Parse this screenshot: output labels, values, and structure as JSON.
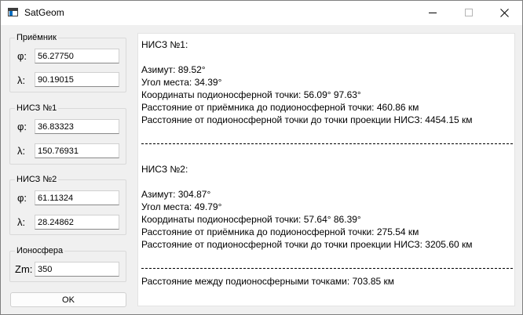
{
  "window": {
    "title": "SatGeom"
  },
  "receiver": {
    "title": "Приёмник",
    "phi_label": "φ:",
    "phi_value": "56.27750",
    "lambda_label": "λ:",
    "lambda_value": "90.19015"
  },
  "sat1": {
    "title": "НИСЗ №1",
    "phi_label": "φ:",
    "phi_value": "36.83323",
    "lambda_label": "λ:",
    "lambda_value": "150.76931"
  },
  "sat2": {
    "title": "НИСЗ №2",
    "phi_label": "φ:",
    "phi_value": "61.11324",
    "lambda_label": "λ:",
    "lambda_value": "28.24862"
  },
  "ionosphere": {
    "title": "Ионосфера",
    "zm_label": "Zm:",
    "zm_value": "350"
  },
  "ok_label": "OK",
  "output": {
    "sat1_header": "НИСЗ №1:",
    "sat1_azimuth": "Азимут: 89.52°",
    "sat1_elevation": "Угол места: 34.39°",
    "sat1_coords": "Координаты подионосферной точки: 56.09° 97.63°",
    "sat1_dist_receiver": "Расстояние от приёмника до подионосферной точки: 460.86 км",
    "sat1_dist_projection": "Расстояние от подионосферной точки до точки проекции НИСЗ: 4454.15 км",
    "sat2_header": "НИСЗ №2:",
    "sat2_azimuth": "Азимут: 304.87°",
    "sat2_elevation": "Угол места: 49.79°",
    "sat2_coords": "Координаты подионосферной точки: 57.64° 86.39°",
    "sat2_dist_receiver": "Расстояние от приёмника до подионосферной точки: 275.54 км",
    "sat2_dist_projection": "Расстояние от подионосферной точки до точки проекции НИСЗ: 3205.60 км",
    "distance_between": "Расстояние между подионосферными точками: 703.85 км"
  }
}
